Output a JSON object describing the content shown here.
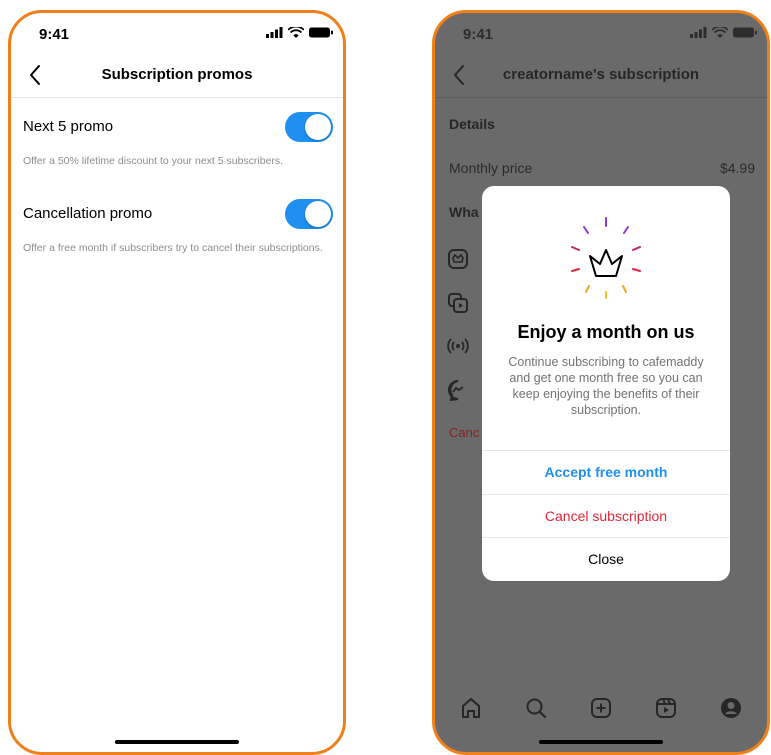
{
  "left_screen": {
    "status_time": "9:41",
    "nav_title": "Subscription promos",
    "settings": [
      {
        "label": "Next 5 promo",
        "enabled": true,
        "description": "Offer a 50% lifetime discount to your next 5 subscribers."
      },
      {
        "label": "Cancellation promo",
        "enabled": true,
        "description": "Offer a free month if subscribers try to cancel their subscriptions."
      }
    ]
  },
  "right_screen": {
    "status_time": "9:41",
    "nav_title": "creatorname's subscription",
    "details_heading": "Details",
    "monthly_price_label": "Monthly price",
    "monthly_price_value": "$4.99",
    "whats_included_partial": "Wha",
    "cancel_partial": "Canc",
    "modal": {
      "title": "Enjoy a month on us",
      "body": "Continue subscribing to cafemaddy and get one month free so you can keep enjoying the benefits of their subscription.",
      "accept_label": "Accept free month",
      "cancel_label": "Cancel subscription",
      "close_label": "Close"
    },
    "tabs": [
      "home-icon",
      "search-icon",
      "create-icon",
      "reels-icon",
      "profile-icon"
    ]
  },
  "colors": {
    "frame_border": "#f08019",
    "toggle_on": "#1f8ff0",
    "accept_blue": "#1f8ff0",
    "cancel_red": "#e0263a",
    "overlay_gray": "#6a6a6a"
  }
}
